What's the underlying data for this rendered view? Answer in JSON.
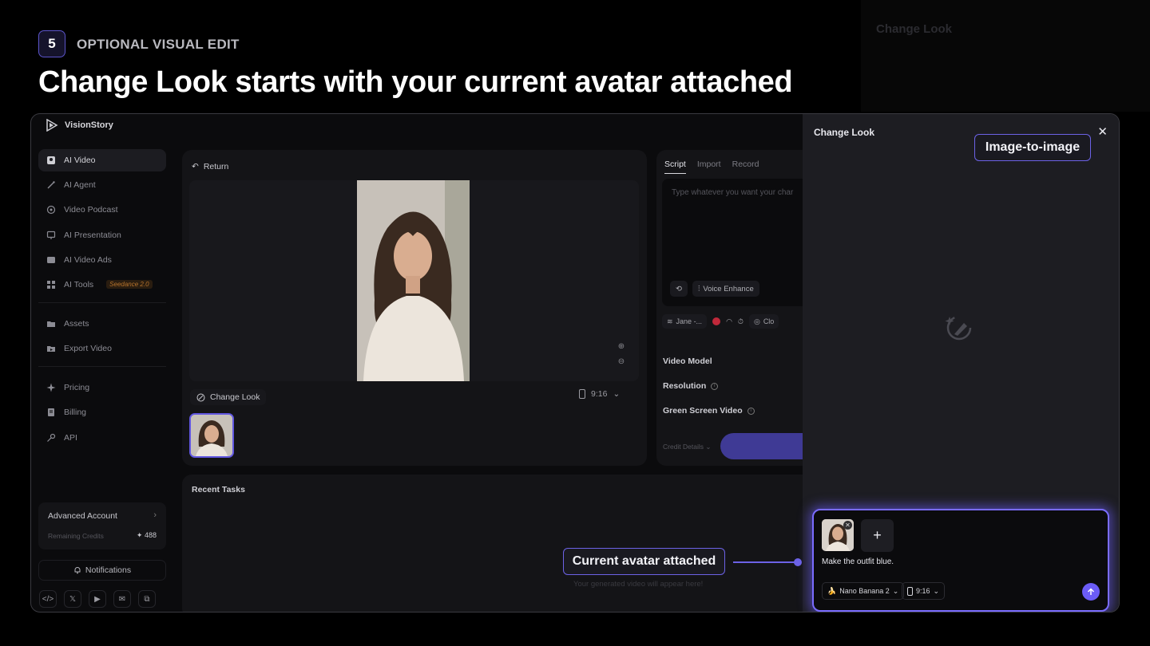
{
  "slide": {
    "step_number": "5",
    "step_label": "OPTIONAL VISUAL EDIT",
    "title": "Change Look starts with your current avatar attached",
    "ghost_label": "Change Look"
  },
  "app": {
    "brand": "VisionStory",
    "sidebar": {
      "items": [
        {
          "label": "AI Video",
          "icon": "video-icon",
          "active": true
        },
        {
          "label": "AI Agent",
          "icon": "wand-icon"
        },
        {
          "label": "Video Podcast",
          "icon": "podcast-icon"
        },
        {
          "label": "AI Presentation",
          "icon": "presentation-icon"
        },
        {
          "label": "AI Video Ads",
          "icon": "ads-icon"
        },
        {
          "label": "AI Tools",
          "icon": "grid-icon",
          "badge": "Seedance 2.0"
        },
        {
          "label": "Assets",
          "icon": "folder-icon"
        },
        {
          "label": "Export Video",
          "icon": "export-icon"
        },
        {
          "label": "Pricing",
          "icon": "sparkle-icon"
        },
        {
          "label": "Billing",
          "icon": "billing-icon"
        },
        {
          "label": "API",
          "icon": "key-icon"
        }
      ],
      "account": {
        "title": "Advanced Account",
        "credits_label": "Remaining Credits",
        "credits": "488"
      },
      "notifications": "Notifications"
    },
    "preview": {
      "return_label": "Return",
      "change_look_label": "Change Look",
      "ratio": "9:16"
    },
    "script": {
      "tabs": [
        "Script",
        "Import",
        "Record"
      ],
      "placeholder": "Type whatever you want your char",
      "voice_enhance": "Voice Enhance",
      "voice_name": "Jane -...",
      "clone_label": "Clo",
      "video_model": "Video Model",
      "resolution": "Resolution",
      "green_screen": "Green Screen Video",
      "credit_details": "Credit Details"
    },
    "recent": {
      "title": "Recent Tasks",
      "empty": "Your generated video will appear here!"
    },
    "drawer": {
      "title": "Change Look",
      "prompt": "Make the outfit blue.",
      "model": "Nano Banana 2",
      "ratio": "9:16"
    }
  },
  "callouts": {
    "image_to_image": "Image-to-image",
    "current_avatar": "Current avatar attached"
  },
  "colors": {
    "accent": "#6c62e6",
    "background": "#000000",
    "panel": "#141417",
    "drawer": "#1d1d22"
  }
}
